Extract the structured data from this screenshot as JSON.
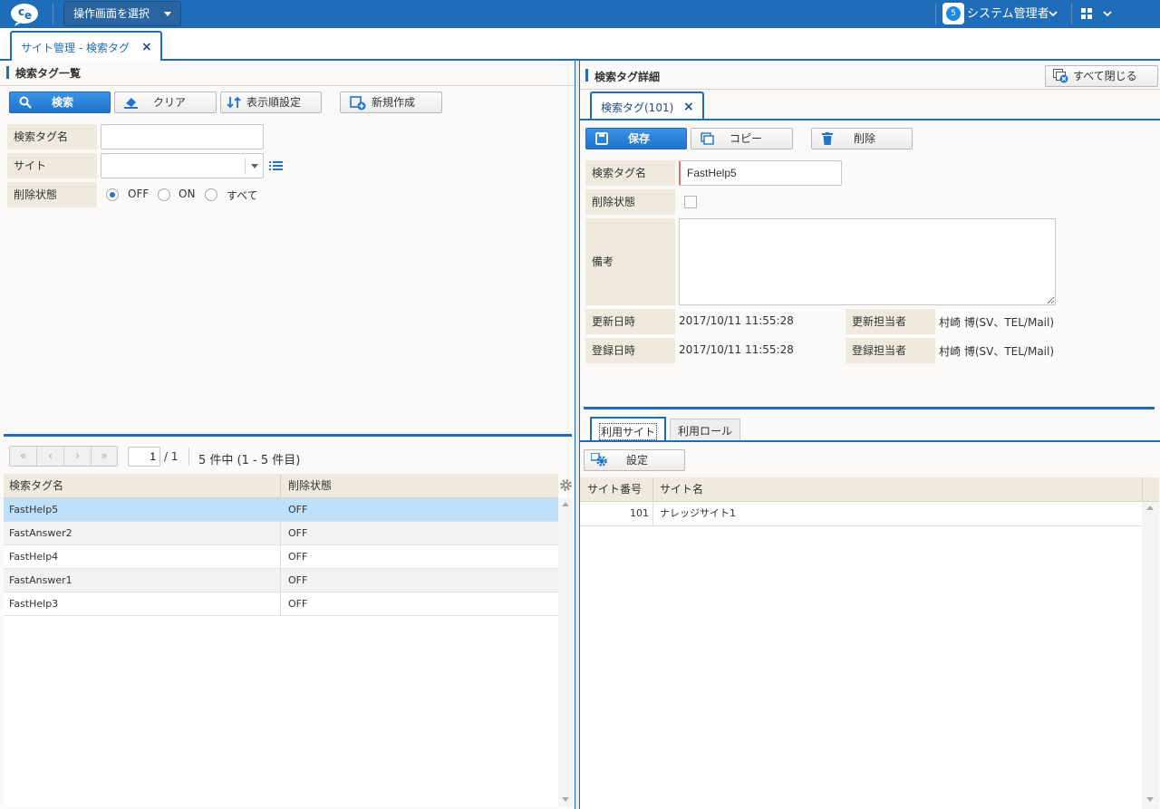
{
  "topbar": {
    "screen_select": "操作画面を選択",
    "user_badge": "5",
    "user_name": "システム管理者",
    "colors": {
      "bar": "#1f6cb8",
      "accent": "#1f74cc"
    }
  },
  "main_tab": {
    "label": "サイト管理 - 検索タグ",
    "close": "×"
  },
  "left": {
    "title": "検索タグ一覧",
    "buttons": {
      "search": "検索",
      "clear": "クリア",
      "sort": "表示順設定",
      "new": "新規作成"
    },
    "form": {
      "tag_name_label": "検索タグ名",
      "tag_name_value": "",
      "site_label": "サイト",
      "site_value": "",
      "delete_state_label": "削除状態",
      "radio_off": "OFF",
      "radio_on": "ON",
      "radio_all": "すべて",
      "radio_selected": "OFF"
    },
    "pager": {
      "page_input": "1",
      "page_total": "/ 1",
      "summary": "5 件中 (1 - 5 件目)"
    },
    "table": {
      "columns": [
        "検索タグ名",
        "削除状態"
      ],
      "rows": [
        [
          "FastHelp5",
          "OFF"
        ],
        [
          "FastAnswer2",
          "OFF"
        ],
        [
          "FastHelp4",
          "OFF"
        ],
        [
          "FastAnswer1",
          "OFF"
        ],
        [
          "FastHelp3",
          "OFF"
        ]
      ],
      "selected_row": 0
    }
  },
  "right": {
    "title": "検索タグ詳細",
    "close_all": "すべて閉じる",
    "detail_tab": {
      "label": "検索タグ(101)",
      "close": "×"
    },
    "buttons": {
      "save": "保存",
      "copy": "コピー",
      "delete": "削除"
    },
    "form": {
      "tag_name_label": "検索タグ名",
      "tag_name_value": "FastHelp5",
      "delete_state_label": "削除状態",
      "remarks_label": "備考",
      "remarks_value": "",
      "updated_at_label": "更新日時",
      "updated_at_value": "2017/10/11 11:55:28",
      "updated_by_label": "更新担当者",
      "updated_by_value": "村崎 博(SV、TEL/Mail)",
      "created_at_label": "登録日時",
      "created_at_value": "2017/10/11 11:55:28",
      "created_by_label": "登録担当者",
      "created_by_value": "村崎 博(SV、TEL/Mail)"
    },
    "sub_tabs": {
      "sites": "利用サイト",
      "roles": "利用ロール"
    },
    "settings_button": "設定",
    "site_table": {
      "columns": [
        "サイト番号",
        "サイト名"
      ],
      "rows": [
        [
          "101",
          "ナレッジサイト1"
        ]
      ]
    }
  }
}
